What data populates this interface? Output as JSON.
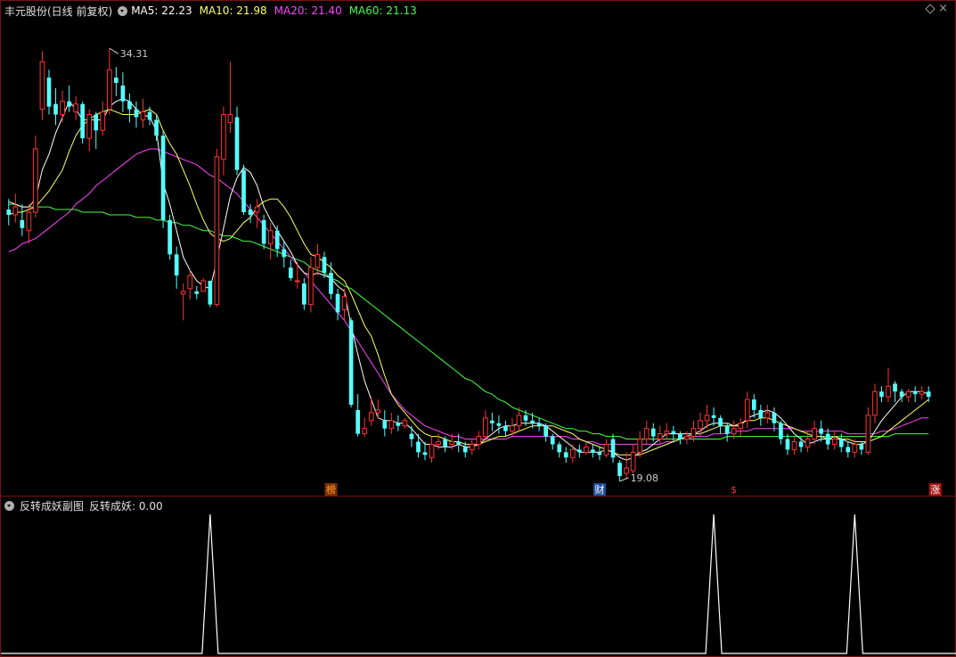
{
  "header": {
    "stock_title": "丰元股份(日线 前复权)",
    "ma_labels": [
      {
        "text": "MA5: 22.23",
        "color": "#ffffff"
      },
      {
        "text": "MA10: 21.98",
        "color": "#ffff66"
      },
      {
        "text": "MA20: 21.40",
        "color": "#ff44ff"
      },
      {
        "text": "MA60: 21.13",
        "color": "#44ff44"
      }
    ]
  },
  "sub_header": {
    "indicator_name": "反转成妖副图",
    "indicator_value": "反转成妖: 0.00"
  },
  "markers": {
    "high_label": "34.31",
    "low_label": "19.08",
    "events": [
      {
        "text": "榜",
        "color": "#ff9933",
        "bg": "#7a3000",
        "index": 48
      },
      {
        "text": "财",
        "color": "#ffffff",
        "bg": "#1f4d99",
        "index": 88
      },
      {
        "text": "$",
        "color": "#ff3333",
        "bg": "#000000",
        "index": 108
      },
      {
        "text": "涨",
        "color": "#ffffff",
        "bg": "#aa1111",
        "index": 138
      }
    ]
  },
  "colors": {
    "up": "#ff3333",
    "down": "#55ffff",
    "ma5": "#ffffff",
    "ma10": "#ffff66",
    "ma20": "#ff44ff",
    "ma60": "#44ff44",
    "border": "#7a1010",
    "sub_line": "#ffffff"
  },
  "chart_data": {
    "type": "candlestick",
    "ylim": [
      18.2,
      35.5
    ],
    "candles": [
      [
        28.2,
        28.0,
        28.6,
        27.6
      ],
      [
        28.0,
        28.3,
        28.8,
        27.7
      ],
      [
        27.8,
        27.5,
        28.4,
        27.2
      ],
      [
        27.4,
        28.1,
        28.4,
        26.9
      ],
      [
        28.1,
        30.5,
        31.0,
        27.9
      ],
      [
        32.0,
        33.8,
        34.2,
        31.6
      ],
      [
        33.2,
        32.1,
        33.5,
        31.8
      ],
      [
        32.2,
        31.8,
        32.8,
        31.4
      ],
      [
        31.8,
        32.3,
        32.7,
        31.5
      ],
      [
        32.3,
        32.1,
        32.9,
        31.9
      ],
      [
        31.9,
        32.2,
        32.5,
        31.6
      ],
      [
        32.2,
        30.9,
        32.3,
        30.7
      ],
      [
        30.9,
        31.8,
        32.0,
        30.4
      ],
      [
        31.8,
        31.2,
        31.9,
        30.5
      ],
      [
        31.2,
        31.9,
        32.3,
        31.0
      ],
      [
        32.0,
        33.5,
        34.31,
        31.8
      ],
      [
        33.2,
        33.0,
        33.6,
        32.5
      ],
      [
        32.9,
        32.3,
        33.4,
        31.9
      ],
      [
        32.3,
        32.0,
        32.6,
        31.5
      ],
      [
        32.0,
        31.7,
        32.3,
        31.3
      ],
      [
        31.6,
        31.9,
        32.4,
        31.3
      ],
      [
        31.9,
        31.6,
        32.1,
        31.4
      ],
      [
        31.6,
        31.0,
        31.8,
        30.8
      ],
      [
        31.0,
        27.8,
        31.2,
        27.5
      ],
      [
        27.8,
        26.5,
        28.0,
        26.3
      ],
      [
        26.5,
        25.7,
        26.8,
        25.2
      ],
      [
        25.0,
        25.1,
        25.4,
        24.0
      ],
      [
        25.2,
        25.7,
        25.9,
        24.8
      ],
      [
        25.1,
        25.0,
        25.3,
        24.8
      ],
      [
        25.1,
        25.5,
        25.6,
        25.2
      ],
      [
        25.5,
        24.6,
        25.5,
        24.5
      ],
      [
        24.6,
        30.2,
        30.5,
        24.5
      ],
      [
        30.1,
        31.8,
        32.1,
        29.5
      ],
      [
        31.5,
        31.8,
        33.8,
        31.1
      ],
      [
        31.7,
        29.7,
        32.1,
        29.5
      ],
      [
        29.7,
        28.1,
        29.9,
        28.0
      ],
      [
        28.2,
        28.0,
        28.4,
        27.7
      ],
      [
        28.1,
        28.3,
        28.6,
        27.5
      ],
      [
        27.8,
        26.9,
        28.0,
        26.7
      ],
      [
        26.9,
        27.4,
        27.7,
        26.3
      ],
      [
        27.4,
        26.7,
        27.6,
        26.4
      ],
      [
        26.7,
        26.4,
        27.0,
        26.0
      ],
      [
        26.0,
        25.6,
        26.3,
        25.5
      ],
      [
        25.5,
        25.5,
        26.2,
        25.2
      ],
      [
        25.4,
        24.6,
        25.6,
        24.4
      ],
      [
        24.6,
        26.0,
        26.4,
        24.3
      ],
      [
        26.0,
        26.5,
        26.9,
        25.7
      ],
      [
        26.4,
        25.8,
        26.6,
        25.6
      ],
      [
        25.8,
        25.0,
        26.2,
        24.8
      ],
      [
        25.0,
        24.3,
        25.2,
        24.0
      ],
      [
        24.4,
        24.9,
        25.2,
        24.0
      ],
      [
        24.0,
        20.8,
        24.1,
        20.7
      ],
      [
        20.6,
        19.7,
        21.2,
        19.6
      ],
      [
        19.7,
        19.9,
        20.3,
        19.6
      ],
      [
        20.2,
        20.5,
        21.1,
        20.0
      ],
      [
        20.5,
        20.6,
        21.0,
        20.3
      ],
      [
        20.2,
        19.9,
        20.6,
        19.6
      ],
      [
        19.9,
        20.2,
        20.5,
        19.7
      ],
      [
        20.1,
        20.0,
        20.4,
        19.8
      ],
      [
        20.0,
        20.2,
        20.3,
        19.9
      ],
      [
        19.7,
        19.5,
        20.0,
        19.2
      ],
      [
        19.4,
        19.0,
        19.7,
        18.8
      ],
      [
        19.0,
        18.9,
        19.4,
        18.7
      ],
      [
        18.8,
        19.3,
        19.6,
        18.6
      ],
      [
        19.3,
        19.4,
        19.7,
        19.1
      ],
      [
        19.5,
        19.2,
        19.6,
        19.0
      ],
      [
        19.3,
        19.4,
        19.7,
        19.1
      ],
      [
        19.4,
        19.3,
        19.7,
        19.0
      ],
      [
        19.2,
        19.0,
        19.4,
        18.8
      ],
      [
        19.1,
        19.3,
        19.5,
        18.9
      ],
      [
        19.3,
        19.6,
        19.8,
        19.1
      ],
      [
        19.6,
        20.3,
        20.6,
        19.4
      ],
      [
        20.2,
        20.1,
        20.5,
        19.8
      ],
      [
        20.1,
        20.0,
        20.4,
        19.7
      ],
      [
        20.0,
        19.8,
        20.2,
        19.6
      ],
      [
        19.8,
        20.0,
        20.3,
        19.6
      ],
      [
        20.0,
        20.4,
        20.7,
        19.8
      ],
      [
        20.4,
        20.2,
        20.6,
        20.0
      ],
      [
        20.2,
        20.1,
        20.5,
        19.9
      ],
      [
        20.1,
        20.0,
        20.3,
        19.8
      ],
      [
        20.0,
        19.6,
        20.1,
        19.4
      ],
      [
        19.6,
        19.3,
        19.7,
        19.1
      ],
      [
        19.3,
        19.0,
        19.4,
        18.8
      ],
      [
        19.0,
        18.8,
        19.2,
        18.6
      ],
      [
        18.8,
        19.1,
        19.3,
        18.6
      ],
      [
        19.1,
        19.0,
        19.3,
        18.8
      ],
      [
        19.0,
        19.2,
        19.4,
        18.9
      ],
      [
        19.1,
        19.0,
        19.3,
        18.8
      ],
      [
        19.0,
        18.9,
        19.2,
        18.7
      ],
      [
        18.9,
        19.3,
        19.5,
        18.8
      ],
      [
        19.5,
        18.8,
        19.7,
        18.6
      ],
      [
        18.6,
        18.1,
        18.7,
        17.9
      ],
      [
        18.2,
        18.4,
        19.0,
        18.0
      ],
      [
        18.3,
        19.0,
        19.3,
        18.2
      ],
      [
        19.0,
        19.5,
        19.8,
        18.8
      ],
      [
        19.5,
        19.9,
        20.2,
        19.3
      ],
      [
        19.9,
        19.6,
        20.1,
        19.4
      ],
      [
        19.5,
        19.7,
        20.0,
        19.3
      ],
      [
        19.7,
        19.8,
        20.1,
        19.5
      ],
      [
        19.8,
        19.7,
        20.0,
        19.4
      ],
      [
        19.7,
        19.5,
        19.8,
        19.3
      ],
      [
        19.5,
        19.6,
        19.8,
        19.3
      ],
      [
        19.6,
        19.9,
        20.2,
        19.4
      ],
      [
        19.9,
        20.2,
        20.5,
        19.6
      ],
      [
        20.2,
        20.4,
        20.8,
        19.9
      ],
      [
        20.4,
        20.3,
        20.7,
        20.0
      ],
      [
        20.3,
        20.0,
        20.4,
        19.7
      ],
      [
        20.0,
        19.7,
        20.1,
        19.4
      ],
      [
        19.7,
        19.9,
        20.2,
        19.5
      ],
      [
        19.9,
        20.1,
        20.3,
        19.6
      ],
      [
        20.2,
        21.0,
        21.3,
        19.9
      ],
      [
        21.0,
        20.6,
        21.2,
        20.3
      ],
      [
        20.6,
        20.3,
        20.8,
        20.0
      ],
      [
        20.3,
        20.5,
        20.8,
        20.1
      ],
      [
        20.5,
        20.1,
        20.7,
        19.8
      ],
      [
        20.1,
        19.5,
        20.2,
        19.3
      ],
      [
        19.5,
        19.1,
        19.7,
        18.9
      ],
      [
        19.1,
        19.4,
        19.6,
        18.9
      ],
      [
        19.4,
        19.2,
        19.6,
        19.0
      ],
      [
        19.2,
        19.5,
        19.8,
        19.0
      ],
      [
        19.5,
        19.9,
        20.2,
        19.3
      ],
      [
        19.9,
        19.7,
        20.2,
        19.4
      ],
      [
        19.7,
        19.3,
        19.9,
        19.1
      ],
      [
        19.3,
        19.5,
        19.8,
        19.1
      ],
      [
        19.5,
        19.2,
        19.7,
        19.0
      ],
      [
        19.2,
        19.0,
        19.4,
        18.8
      ],
      [
        19.0,
        19.3,
        19.5,
        18.8
      ],
      [
        19.3,
        19.1,
        19.4,
        18.9
      ],
      [
        19.0,
        20.4,
        20.7,
        18.9
      ],
      [
        20.4,
        21.3,
        21.6,
        20.1
      ],
      [
        21.3,
        21.1,
        21.5,
        20.9
      ],
      [
        21.1,
        21.5,
        22.2,
        20.9
      ],
      [
        21.6,
        21.3,
        21.7,
        20.9
      ],
      [
        21.3,
        21.1,
        21.4,
        20.9
      ],
      [
        21.1,
        21.3,
        21.4,
        20.9
      ],
      [
        21.3,
        21.2,
        21.5,
        20.9
      ],
      [
        21.2,
        21.3,
        21.5,
        21.0
      ],
      [
        21.3,
        21.1,
        21.5,
        20.9
      ]
    ],
    "ma5": [
      28.5,
      28.4,
      28.3,
      28.3,
      28.6,
      29.7,
      30.3,
      31.1,
      31.7,
      32.3,
      32.0,
      31.6,
      31.6,
      31.6,
      31.6,
      32.1,
      32.3,
      32.4,
      32.3,
      32.0,
      31.8,
      31.7,
      31.2,
      29.2,
      28.4,
      27.4,
      26.4,
      25.9,
      25.5,
      25.3,
      25.2,
      26.3,
      27.5,
      28.7,
      29.4,
      29.8,
      29.6,
      29.1,
      28.3,
      27.8,
      27.4,
      27.0,
      26.6,
      26.1,
      25.8,
      25.7,
      25.8,
      25.7,
      25.6,
      25.3,
      25.1,
      23.8,
      22.7,
      21.7,
      21.0,
      20.3,
      20.2,
      20.2,
      20.1,
      20.1,
      19.9,
      19.6,
      19.3,
      19.3,
      19.2,
      19.2,
      19.2,
      19.3,
      19.2,
      19.2,
      19.3,
      19.5,
      19.7,
      19.9,
      20.0,
      20.0,
      20.1,
      20.1,
      20.1,
      20.1,
      20.0,
      19.8,
      19.6,
      19.4,
      19.2,
      19.0,
      19.0,
      19.0,
      19.0,
      19.1,
      19.0,
      18.8,
      18.7,
      18.8,
      19.0,
      19.1,
      19.3,
      19.5,
      19.7,
      19.7,
      19.7,
      19.7,
      19.7,
      19.8,
      20.0,
      20.1,
      20.1,
      20.1,
      20.0,
      20.0,
      20.3,
      20.4,
      20.5,
      20.6,
      20.5,
      20.3,
      20.0,
      19.7,
      19.5,
      19.3,
      19.4,
      19.5,
      19.5,
      19.6,
      19.5,
      19.4,
      19.3,
      19.3,
      19.4,
      19.8,
      20.2,
      20.5,
      20.8,
      21.1,
      21.3,
      21.3,
      21.3,
      21.2
    ],
    "ma10": [
      28.0,
      28.1,
      28.1,
      28.2,
      28.3,
      28.6,
      28.9,
      29.3,
      29.7,
      30.4,
      31.0,
      31.4,
      31.6,
      31.8,
      31.9,
      32.0,
      31.9,
      31.8,
      31.8,
      31.8,
      31.9,
      32.0,
      31.8,
      31.2,
      30.7,
      30.3,
      29.7,
      29.1,
      28.4,
      27.8,
      27.3,
      27.1,
      27.0,
      27.1,
      27.4,
      27.7,
      27.9,
      28.3,
      28.5,
      28.6,
      28.6,
      28.3,
      27.9,
      27.4,
      26.9,
      26.5,
      26.4,
      26.2,
      26.0,
      25.7,
      25.5,
      25.0,
      24.4,
      23.8,
      23.4,
      22.7,
      21.9,
      21.2,
      20.8,
      20.5,
      20.2,
      19.9,
      19.7,
      19.6,
      19.6,
      19.5,
      19.4,
      19.4,
      19.3,
      19.3,
      19.3,
      19.4,
      19.5,
      19.6,
      19.6,
      19.7,
      19.8,
      19.9,
      20.0,
      20.0,
      20.0,
      20.0,
      19.9,
      19.8,
      19.7,
      19.5,
      19.4,
      19.3,
      19.2,
      19.1,
      19.0,
      18.9,
      18.9,
      18.9,
      18.9,
      19.0,
      19.1,
      19.2,
      19.3,
      19.4,
      19.5,
      19.6,
      19.7,
      19.7,
      19.8,
      19.9,
      20.0,
      20.0,
      20.0,
      20.1,
      20.2,
      20.2,
      20.3,
      20.3,
      20.2,
      20.1,
      20.0,
      19.9,
      19.8,
      19.7,
      19.6,
      19.6,
      19.5,
      19.5,
      19.5,
      19.5,
      19.4,
      19.4,
      19.4,
      19.5,
      19.6,
      19.8,
      20.0,
      20.2,
      20.4,
      20.6,
      20.8,
      21.0
    ],
    "ma20": [
      26.6,
      26.7,
      26.9,
      27.0,
      27.1,
      27.3,
      27.5,
      27.7,
      27.9,
      28.1,
      28.4,
      28.6,
      28.8,
      29.1,
      29.3,
      29.5,
      29.7,
      29.9,
      30.1,
      30.3,
      30.4,
      30.5,
      30.5,
      30.4,
      30.3,
      30.2,
      30.1,
      30.0,
      29.9,
      29.7,
      29.5,
      29.4,
      29.2,
      29.0,
      28.8,
      28.5,
      28.2,
      27.9,
      27.6,
      27.3,
      27.0,
      26.7,
      26.4,
      26.1,
      25.8,
      25.5,
      25.2,
      24.9,
      24.6,
      24.3,
      24.0,
      23.6,
      23.2,
      22.8,
      22.4,
      22.0,
      21.6,
      21.2,
      20.9,
      20.6,
      20.4,
      20.2,
      20.0,
      19.9,
      19.8,
      19.7,
      19.6,
      19.6,
      19.5,
      19.5,
      19.5,
      19.5,
      19.5,
      19.5,
      19.5,
      19.6,
      19.6,
      19.6,
      19.6,
      19.6,
      19.6,
      19.6,
      19.6,
      19.6,
      19.5,
      19.5,
      19.4,
      19.4,
      19.3,
      19.3,
      19.3,
      19.3,
      19.3,
      19.3,
      19.3,
      19.3,
      19.3,
      19.3,
      19.4,
      19.4,
      19.5,
      19.5,
      19.6,
      19.6,
      19.6,
      19.7,
      19.7,
      19.7,
      19.8,
      19.8,
      19.8,
      19.9,
      19.9,
      19.9,
      19.9,
      19.9,
      19.9,
      19.9,
      19.8,
      19.8,
      19.8,
      19.8,
      19.8,
      19.8,
      19.8,
      19.7,
      19.7,
      19.7,
      19.7,
      19.7,
      19.8,
      19.8,
      19.9,
      20.0,
      20.1,
      20.2,
      20.3,
      20.3
    ],
    "ma60": [
      28.4,
      28.4,
      28.3,
      28.3,
      28.3,
      28.3,
      28.3,
      28.2,
      28.2,
      28.2,
      28.2,
      28.1,
      28.1,
      28.1,
      28.1,
      28.0,
      28.0,
      28.0,
      28.0,
      27.9,
      27.9,
      27.9,
      27.8,
      27.8,
      27.7,
      27.7,
      27.6,
      27.6,
      27.5,
      27.4,
      27.4,
      27.3,
      27.2,
      27.2,
      27.1,
      27.0,
      27.0,
      26.9,
      26.8,
      26.7,
      26.6,
      26.5,
      26.4,
      26.3,
      26.2,
      26.0,
      25.9,
      25.8,
      25.6,
      25.5,
      25.3,
      25.2,
      25.0,
      24.8,
      24.6,
      24.4,
      24.2,
      24.0,
      23.8,
      23.6,
      23.4,
      23.2,
      23.0,
      22.8,
      22.6,
      22.4,
      22.2,
      22.0,
      21.8,
      21.7,
      21.5,
      21.3,
      21.2,
      21.0,
      20.9,
      20.7,
      20.6,
      20.5,
      20.4,
      20.3,
      20.2,
      20.1,
      20.0,
      19.9,
      19.9,
      19.8,
      19.8,
      19.7,
      19.7,
      19.6,
      19.6,
      19.6,
      19.5,
      19.5,
      19.5,
      19.5,
      19.5,
      19.5,
      19.5,
      19.5,
      19.5,
      19.5,
      19.5,
      19.5,
      19.5,
      19.5,
      19.5,
      19.6,
      19.6,
      19.6,
      19.6,
      19.6,
      19.6,
      19.6,
      19.6,
      19.6,
      19.6,
      19.6,
      19.6,
      19.6,
      19.6,
      19.6,
      19.6,
      19.6,
      19.6,
      19.6,
      19.6,
      19.6,
      19.6,
      19.6,
      19.6,
      19.6,
      19.7,
      19.7,
      19.7,
      19.7,
      19.7,
      19.7
    ],
    "signal_spikes": [
      30,
      105,
      126
    ]
  }
}
